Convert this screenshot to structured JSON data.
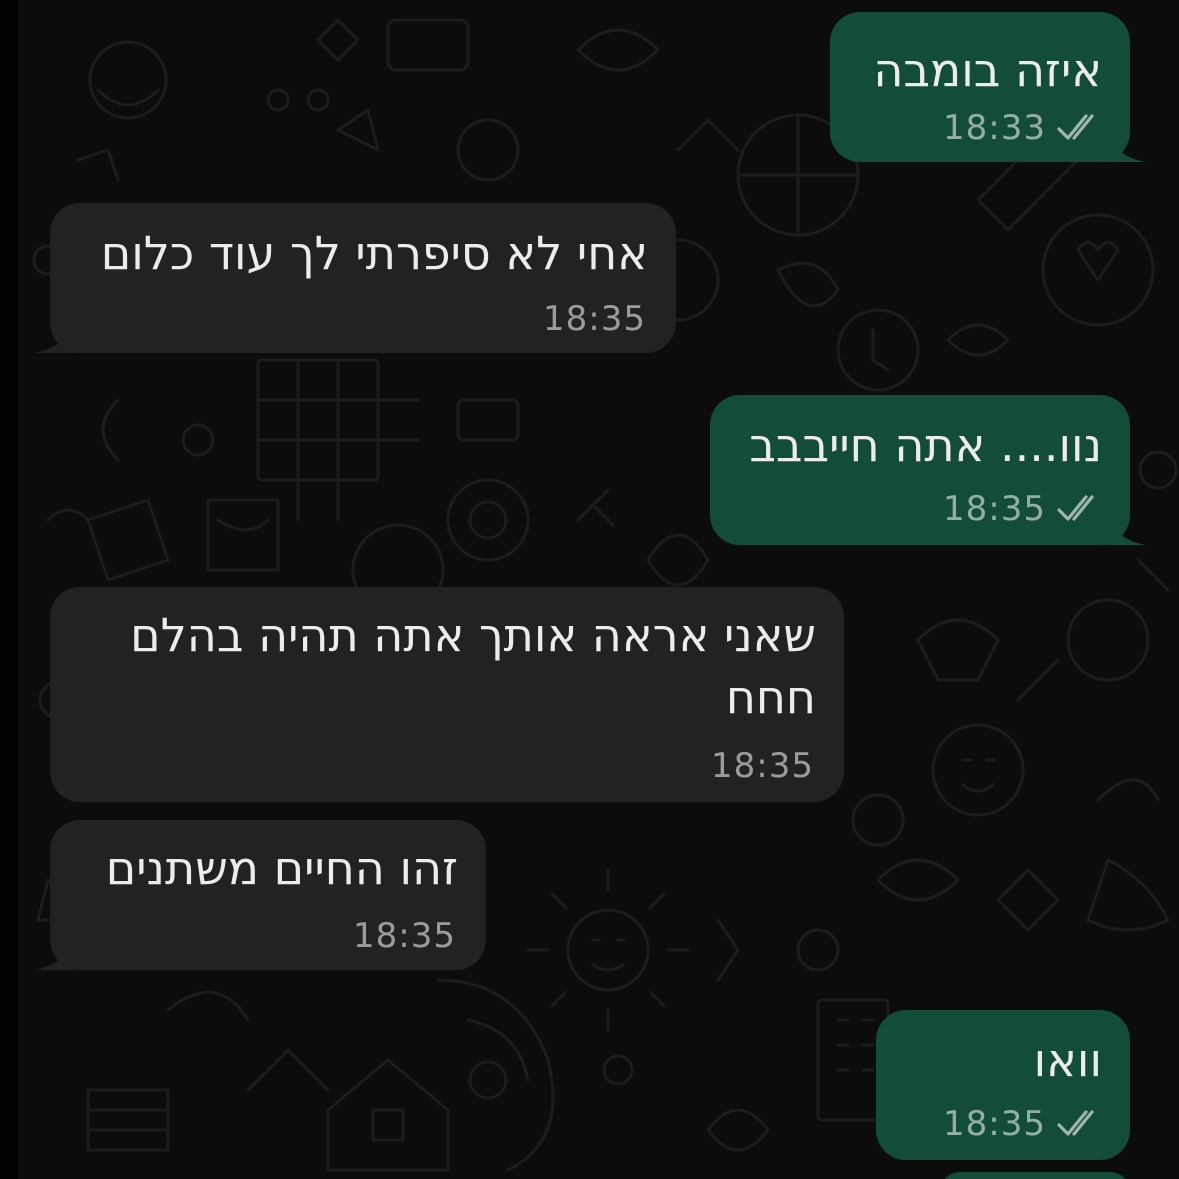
{
  "chat": {
    "messages": [
      {
        "id": "m1",
        "direction": "outgoing",
        "text": "איזה בומבה",
        "time": "18:33",
        "status": "read-ticks-icon"
      },
      {
        "id": "m2",
        "direction": "incoming",
        "text": "אחי לא סיפרתי לך עוד כלום",
        "time": "18:35"
      },
      {
        "id": "m3",
        "direction": "outgoing",
        "text": "נוו.... אתה חייבבב",
        "time": "18:35",
        "status": "read-ticks-icon"
      },
      {
        "id": "m4",
        "direction": "incoming",
        "text_line1": "שאני אראה אותך אתה תהיה בהלם",
        "text_line2": "חחח",
        "time": "18:35"
      },
      {
        "id": "m5",
        "direction": "incoming",
        "text": "זהו החיים משתנים",
        "time": "18:35"
      },
      {
        "id": "m6",
        "direction": "outgoing",
        "text": "וואו",
        "time": "18:35",
        "status": "read-ticks-icon"
      }
    ]
  },
  "colors": {
    "background": "#0c0c0c",
    "outgoing_bubble": "#134d37",
    "incoming_bubble": "#222224",
    "text": "#ececec",
    "meta": "#8f8f8f"
  }
}
